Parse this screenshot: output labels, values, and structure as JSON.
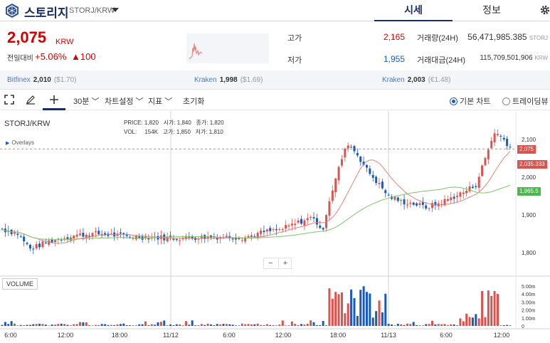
{
  "header": {
    "coin_name": "스토리지",
    "pair": "STORJ/KRW",
    "tabs": [
      {
        "label": "시세"
      },
      {
        "label": "정보"
      }
    ]
  },
  "summary": {
    "price": "2,075",
    "unit": "KRW",
    "change_label": "전일대비",
    "change_pct": "+5.06%",
    "change_abs": "▲100",
    "stats": {
      "high_label": "고가",
      "high_value": "2,165",
      "low_label": "저가",
      "low_value": "1,955",
      "volume_label": "거래량(24H)",
      "volume_value": "56,471,985.385",
      "volume_unit": "STORJ",
      "amount_label": "거래대금(24H)",
      "amount_value": "115,709,501,906",
      "amount_unit": "KRW"
    },
    "colors": {
      "up": "#d60000",
      "down": "#1a5ab8"
    }
  },
  "exchanges": [
    {
      "name": "Bitfinex",
      "price": "2,010",
      "sub": "($1.70)"
    },
    {
      "name": "Kraken",
      "price": "1,998",
      "sub": "($1.69)"
    },
    {
      "name": "Kraken",
      "price": "2,003",
      "sub": "(€1.48)"
    }
  ],
  "toolbar": {
    "interval": "30분",
    "chart_settings": "차트설정",
    "indicators": "지표",
    "reset": "초기화",
    "basic_chart": "기본 차트",
    "trading_view": "트레이딩뷰"
  },
  "chart": {
    "pair_title": "STORJ/KRW",
    "ohlc_row1": {
      "price_label": "PRICE:",
      "price": "1,820",
      "open_label": "시가:",
      "open": "1,840",
      "close_label": "종가:",
      "close": "1,820"
    },
    "ohlc_row2": {
      "vol_label": "VOL:",
      "vol": "154K",
      "high_label": "고가:",
      "high": "1,850",
      "low_label": "저가:",
      "low": "1,810"
    },
    "overlays_label": "Overlays",
    "zoom_out": "−",
    "zoom_in": "+",
    "volume_label": "VOLUME",
    "price_tag": "2,075",
    "ma_short_tag": "2,035.333",
    "ma_long_tag": "1,965.5"
  },
  "chart_data": {
    "type": "candlestick",
    "price_axis": {
      "ticks": [
        1800,
        1900,
        2000,
        2100
      ],
      "tick_labels": [
        "1,800",
        "1,900",
        "2,000",
        "2,100"
      ]
    },
    "volume_axis": {
      "ticks": [
        0,
        1,
        2,
        3,
        4,
        5
      ],
      "tick_labels": [
        "0",
        "1.00m",
        "2.00m",
        "3.00m",
        "4.00m",
        "5.00m"
      ]
    },
    "time_labels": [
      "6:00",
      "12:00",
      "18:00",
      "11/12",
      "6:00",
      "12:00",
      "18:00",
      "11/13",
      "6:00",
      "12:00"
    ],
    "current_price": 2075,
    "colors": {
      "up": "#d9534f",
      "down": "#1a5ab8",
      "ma_short": "#e8827a",
      "ma_long": "#7cc76b",
      "tag_price": "#d9534f",
      "tag_short": "#d9534f",
      "tag_long": "#4cb84c"
    }
  }
}
